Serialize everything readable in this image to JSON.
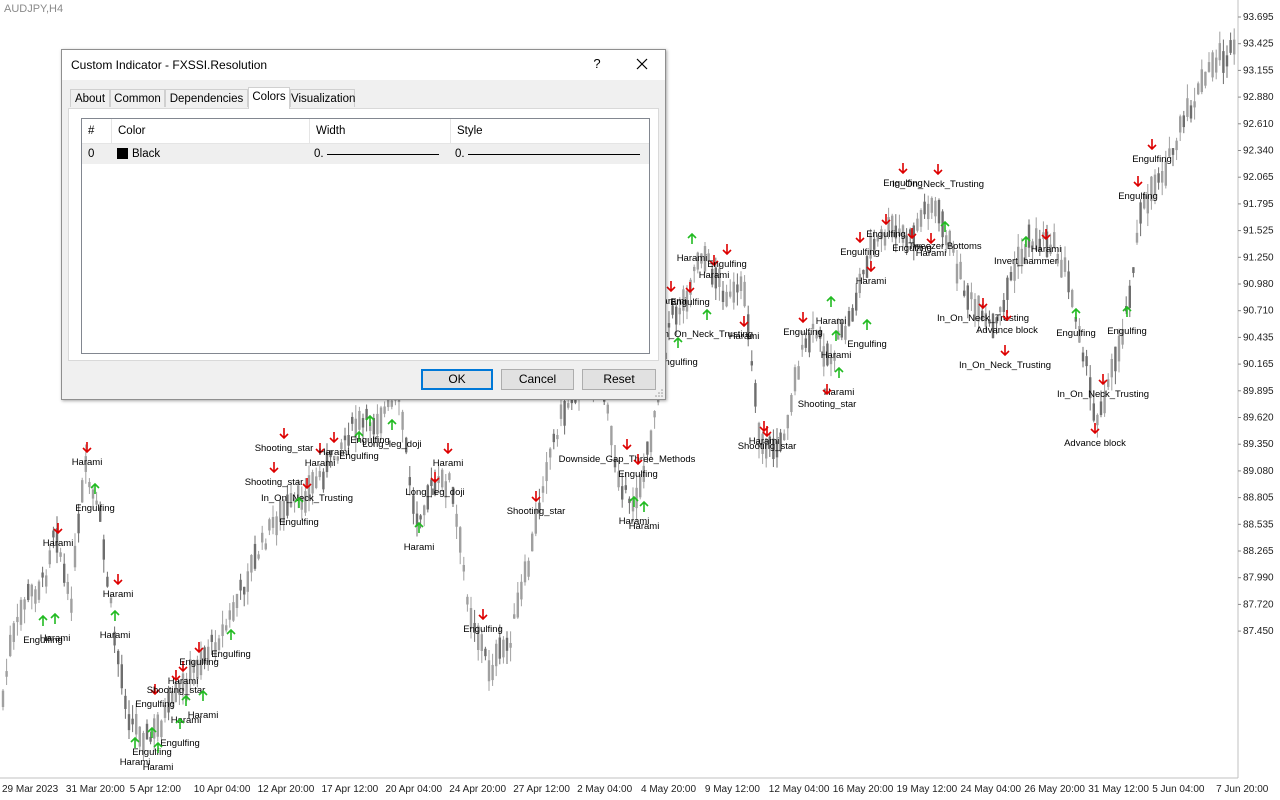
{
  "chart": {
    "symbol": "AUDJPY,H4",
    "price_labels": [
      "93.695",
      "93.425",
      "93.155",
      "92.880",
      "92.610",
      "92.340",
      "92.065",
      "91.795",
      "91.525",
      "91.250",
      "90.980",
      "90.710",
      "90.435",
      "90.165",
      "89.895",
      "89.620",
      "89.350",
      "89.080",
      "88.805",
      "88.535",
      "88.265",
      "87.990",
      "87.720",
      "87.450"
    ],
    "time_labels": [
      "29 Mar 2023",
      "31 Mar 20:00",
      "5 Apr 12:00",
      "10 Apr 04:00",
      "12 Apr 20:00",
      "17 Apr 12:00",
      "20 Apr 04:00",
      "24 Apr 20:00",
      "27 Apr 12:00",
      "2 May 04:00",
      "4 May 20:00",
      "9 May 12:00",
      "12 May 04:00",
      "16 May 20:00",
      "19 May 12:00",
      "24 May 04:00",
      "26 May 20:00",
      "31 May 12:00",
      "5 Jun 04:00",
      "7 Jun 20:00"
    ],
    "patterns": [
      {
        "text": "Harami",
        "dir": "down"
      },
      {
        "text": "Engulfing",
        "dir": "up"
      },
      {
        "text": "Harami",
        "dir": "down"
      },
      {
        "text": "Engulfing",
        "dir": "up"
      },
      {
        "text": "Harami",
        "dir": "up"
      },
      {
        "text": "Harami",
        "dir": "down"
      },
      {
        "text": "Harami",
        "dir": "up"
      },
      {
        "text": "Engulfing",
        "dir": "down"
      },
      {
        "text": "Harami",
        "dir": "down"
      },
      {
        "text": "Shooting_star",
        "dir": "down"
      },
      {
        "text": "Engulfing",
        "dir": "down"
      },
      {
        "text": "Harami",
        "dir": "up"
      },
      {
        "text": "Harami",
        "dir": "up"
      },
      {
        "text": "Engulfing",
        "dir": "up"
      },
      {
        "text": "Engulfing",
        "dir": "up"
      },
      {
        "text": "Harami",
        "dir": "up"
      },
      {
        "text": "Harami",
        "dir": "up"
      },
      {
        "text": "Engulfing",
        "dir": "up"
      },
      {
        "text": "Shooting_star",
        "dir": "down"
      },
      {
        "text": "Harami",
        "dir": "down"
      },
      {
        "text": "Shooting_star",
        "dir": "down"
      },
      {
        "text": "In_On_Neck_Trusting",
        "dir": "down"
      },
      {
        "text": "Engulfing",
        "dir": "up"
      },
      {
        "text": "Harami",
        "dir": "down"
      },
      {
        "text": "Engulfing",
        "dir": "up"
      },
      {
        "text": "Engulfing",
        "dir": "up"
      },
      {
        "text": "Long_leg_doji",
        "dir": "up"
      },
      {
        "text": "Harami",
        "dir": "down"
      },
      {
        "text": "Long_leg_doji",
        "dir": "down"
      },
      {
        "text": "Harami",
        "dir": "up"
      },
      {
        "text": "Engulfing",
        "dir": "down"
      },
      {
        "text": "Shooting_star",
        "dir": "down"
      },
      {
        "text": "Downside_Gap_Three_Methods",
        "dir": "down"
      },
      {
        "text": "Engulfing",
        "dir": "down"
      },
      {
        "text": "Harami",
        "dir": "up"
      },
      {
        "text": "Harami",
        "dir": "up"
      },
      {
        "text": "Engulfing",
        "dir": "up"
      },
      {
        "text": "Harami",
        "dir": "down"
      },
      {
        "text": "Harami",
        "dir": "up"
      },
      {
        "text": "Engulfing",
        "dir": "down"
      },
      {
        "text": "Harami",
        "dir": "down"
      },
      {
        "text": "In_On_Neck_Trusting",
        "dir": "up"
      },
      {
        "text": "Engulfing",
        "dir": "down"
      },
      {
        "text": "Harami",
        "dir": "down"
      },
      {
        "text": "Harami",
        "dir": "down"
      },
      {
        "text": "Shooting_star",
        "dir": "down"
      },
      {
        "text": "Engulfing",
        "dir": "down"
      },
      {
        "text": "Harami",
        "dir": "up"
      },
      {
        "text": "Harami",
        "dir": "up"
      },
      {
        "text": "Harami",
        "dir": "up"
      },
      {
        "text": "Shooting_star",
        "dir": "down"
      },
      {
        "text": "Engulfing",
        "dir": "down"
      },
      {
        "text": "Engulfing",
        "dir": "up"
      },
      {
        "text": "Harami",
        "dir": "down"
      },
      {
        "text": "Engulfing",
        "dir": "down"
      },
      {
        "text": "Engulfing",
        "dir": "down"
      },
      {
        "text": "In_On_Neck_Trusting",
        "dir": "down"
      },
      {
        "text": "Harami",
        "dir": "down"
      },
      {
        "text": "Engulfing",
        "dir": "down"
      },
      {
        "text": "Tweezer Bottoms",
        "dir": "up"
      },
      {
        "text": "In_On_Neck_Trusting",
        "dir": "down"
      },
      {
        "text": "Advance block",
        "dir": "down"
      },
      {
        "text": "In_On_Neck_Trusting",
        "dir": "down"
      },
      {
        "text": "Harami",
        "dir": "down"
      },
      {
        "text": "Invert_hammer",
        "dir": "up"
      },
      {
        "text": "Engulfing",
        "dir": "up"
      },
      {
        "text": "In_On_Neck_Trusting",
        "dir": "down"
      },
      {
        "text": "Advance block",
        "dir": "down"
      },
      {
        "text": "Engulfing",
        "dir": "up"
      },
      {
        "text": "Engulfing",
        "dir": "down"
      },
      {
        "text": "Engulfing",
        "dir": "down"
      }
    ]
  },
  "dialog": {
    "title": "Custom Indicator - FXSSI.Resolution",
    "help_label": "?",
    "tabs": [
      "About",
      "Common",
      "Dependencies",
      "Colors",
      "Visualization"
    ],
    "active_tab": "Colors",
    "columns": [
      "#",
      "Color",
      "Width",
      "Style"
    ],
    "rows": [
      {
        "index": "0",
        "color_name": "Black",
        "color": "#000000",
        "width": "0.",
        "style": "0."
      }
    ],
    "buttons": {
      "ok": "OK",
      "cancel": "Cancel",
      "reset": "Reset"
    }
  },
  "colors": {
    "bull_arrow": "#22bb22",
    "bear_arrow": "#dd0000",
    "candle": "#a0a0a0"
  }
}
